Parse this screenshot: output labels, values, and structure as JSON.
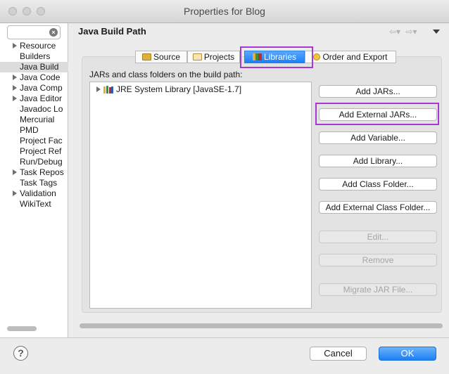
{
  "window": {
    "title": "Properties for Blog",
    "traffic_lights": [
      "close",
      "minimize",
      "zoom"
    ]
  },
  "sidebar": {
    "filter_placeholder": "",
    "items": [
      {
        "label": "Resource",
        "expandable": true
      },
      {
        "label": "Builders",
        "expandable": false
      },
      {
        "label": "Java Build",
        "expandable": false,
        "selected": true
      },
      {
        "label": "Java Code",
        "expandable": true
      },
      {
        "label": "Java Comp",
        "expandable": true
      },
      {
        "label": "Java Editor",
        "expandable": true
      },
      {
        "label": "Javadoc Lo",
        "expandable": false
      },
      {
        "label": "Mercurial",
        "expandable": false
      },
      {
        "label": "PMD",
        "expandable": false
      },
      {
        "label": "Project Fac",
        "expandable": false
      },
      {
        "label": "Project Ref",
        "expandable": false
      },
      {
        "label": "Run/Debug",
        "expandable": false
      },
      {
        "label": "Task Repos",
        "expandable": true
      },
      {
        "label": "Task Tags",
        "expandable": false
      },
      {
        "label": "Validation",
        "expandable": true
      },
      {
        "label": "WikiText",
        "expandable": false
      }
    ]
  },
  "main": {
    "title": "Java Build Path",
    "nav_back": "⇦▾",
    "nav_forward": "⇨▾",
    "tabs": [
      {
        "label": "Source",
        "icon": "source-folder-icon"
      },
      {
        "label": "Projects",
        "icon": "projects-folder-icon"
      },
      {
        "label": "Libraries",
        "icon": "libraries-icon",
        "selected": true
      },
      {
        "label": "Order and Export",
        "icon": "order-export-icon"
      }
    ],
    "list_caption": "JARs and class folders on the build path:",
    "list_items": [
      {
        "label": "JRE System Library [JavaSE-1.7]",
        "icon": "jre-library-icon"
      }
    ],
    "buttons": [
      {
        "label": "Add JARs...",
        "enabled": true
      },
      {
        "label": "Add External JARs...",
        "enabled": true,
        "highlighted": true
      },
      {
        "label": "Add Variable...",
        "enabled": true
      },
      {
        "label": "Add Library...",
        "enabled": true
      },
      {
        "label": "Add Class Folder...",
        "enabled": true
      },
      {
        "label": "Add External Class Folder...",
        "enabled": true
      },
      {
        "label": "Edit...",
        "enabled": false
      },
      {
        "label": "Remove",
        "enabled": false
      },
      {
        "label": "Migrate JAR File...",
        "enabled": false
      }
    ]
  },
  "footer": {
    "help_label": "?",
    "cancel_label": "Cancel",
    "ok_label": "OK"
  },
  "colors": {
    "accent": "#1a80f7",
    "highlight_box": "#a63ad0"
  }
}
